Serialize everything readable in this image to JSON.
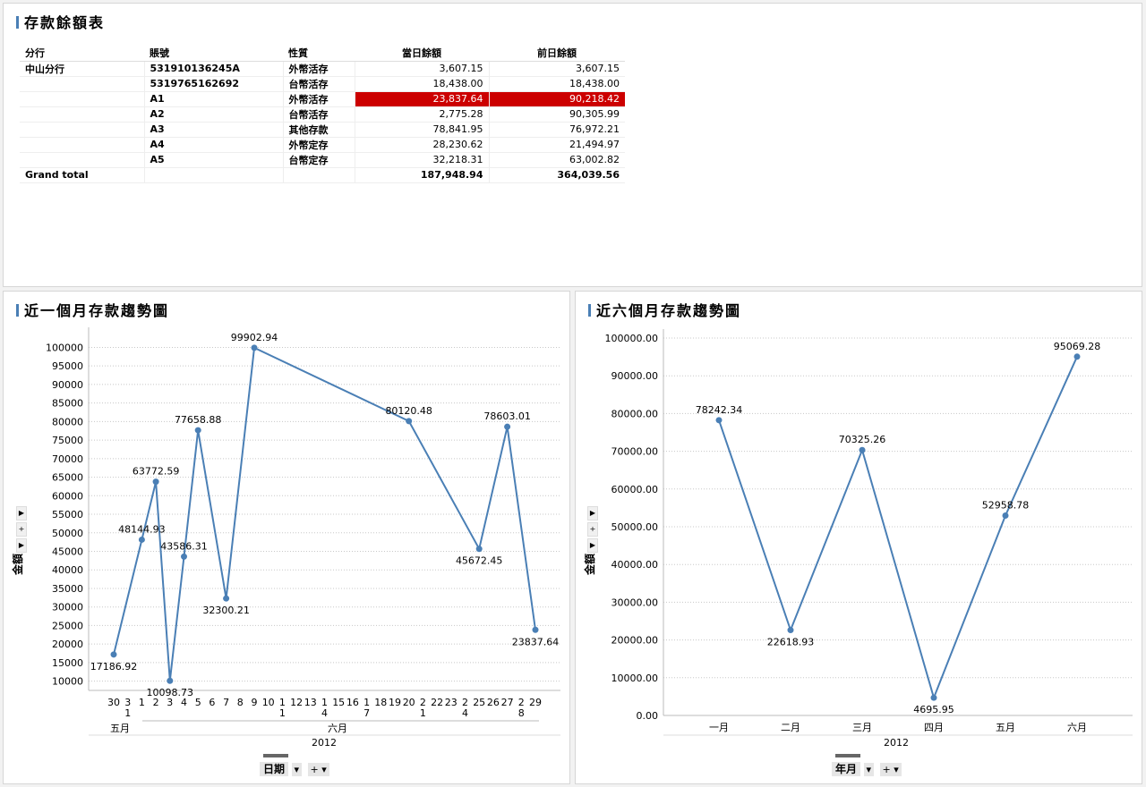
{
  "table_panel": {
    "title": "存款餘額表",
    "headers": [
      "分行",
      "賬號",
      "性質",
      "當日餘額",
      "前日餘額"
    ],
    "branch": "中山分行",
    "rows": [
      {
        "account": "531910136245A",
        "type": "外幣活存",
        "today": "3,607.15",
        "prev": "3,607.15"
      },
      {
        "account": "5319765162692",
        "type": "台幣活存",
        "today": "18,438.00",
        "prev": "18,438.00"
      },
      {
        "account": "A1",
        "type": "外幣活存",
        "today": "23,837.64",
        "prev": "90,218.42"
      },
      {
        "account": "A2",
        "type": "台幣活存",
        "today": "2,775.28",
        "prev": "90,305.99"
      },
      {
        "account": "A3",
        "type": "其他存款",
        "today": "78,841.95",
        "prev": "76,972.21"
      },
      {
        "account": "A4",
        "type": "外幣定存",
        "today": "28,230.62",
        "prev": "21,494.97"
      },
      {
        "account": "A5",
        "type": "台幣定存",
        "today": "32,218.31",
        "prev": "63,002.82"
      }
    ],
    "total_label": "Grand total",
    "total_today": "187,948.94",
    "total_prev": "364,039.56",
    "highlight_color": "#cc0000"
  },
  "chart_month_panel": {
    "title": "近一個月存款趨勢圖",
    "month_may": "五月",
    "month_jun": "六月",
    "year": "2012",
    "control_label": "日期",
    "plus": "+",
    "ylabel": "金額"
  },
  "chart_six_panel": {
    "title": "近六個月存款趨勢圖",
    "year": "2012",
    "control_label": "年月",
    "plus": "+",
    "ylabel": "金額"
  },
  "chart_data": [
    {
      "type": "line",
      "title": "近一個月存款趨勢圖",
      "ylabel": "金額",
      "ylim": [
        7500,
        103000
      ],
      "yticks": [
        10000,
        15000,
        20000,
        25000,
        30000,
        35000,
        40000,
        45000,
        50000,
        55000,
        60000,
        65000,
        70000,
        75000,
        80000,
        85000,
        90000,
        95000,
        100000
      ],
      "categories": [
        "30",
        "31",
        "1",
        "2",
        "3",
        "4",
        "5",
        "6",
        "7",
        "8",
        "9",
        "10",
        "11",
        "12",
        "13",
        "14",
        "15",
        "16",
        "17",
        "18",
        "19",
        "20",
        "21",
        "22",
        "23",
        "24",
        "25",
        "26",
        "27",
        "28",
        "29"
      ],
      "series_color": "#4a7fb5",
      "points": [
        {
          "x": "30",
          "y": 17186.92,
          "label": "17186.92",
          "pos": "below"
        },
        {
          "x": "1",
          "y": 48144.93,
          "label": "48144.93",
          "pos": "above"
        },
        {
          "x": "2",
          "y": 63772.59,
          "label": "63772.59",
          "pos": "above"
        },
        {
          "x": "3",
          "y": 10098.73,
          "label": "10098.73",
          "pos": "below"
        },
        {
          "x": "4",
          "y": 43586.31,
          "label": "43586.31",
          "pos": "above"
        },
        {
          "x": "5",
          "y": 77658.88,
          "label": "77658.88",
          "pos": "above"
        },
        {
          "x": "7",
          "y": 32300.21,
          "label": "32300.21",
          "pos": "below"
        },
        {
          "x": "9",
          "y": 99902.94,
          "label": "99902.94",
          "pos": "above"
        },
        {
          "x": "20",
          "y": 80120.48,
          "label": "80120.48",
          "pos": "above"
        },
        {
          "x": "25",
          "y": 45672.45,
          "label": "45672.45",
          "pos": "below"
        },
        {
          "x": "27",
          "y": 78603.01,
          "label": "78603.01",
          "pos": "above"
        },
        {
          "x": "29",
          "y": 23837.64,
          "label": "23837.64",
          "pos": "below"
        }
      ]
    },
    {
      "type": "line",
      "title": "近六個月存款趨勢圖",
      "ylabel": "金額",
      "ylim": [
        0,
        100000
      ],
      "yticks": [
        "0.00",
        "10000.00",
        "20000.00",
        "30000.00",
        "40000.00",
        "50000.00",
        "60000.00",
        "70000.00",
        "80000.00",
        "90000.00",
        "100000.00"
      ],
      "categories": [
        "一月",
        "二月",
        "三月",
        "四月",
        "五月",
        "六月"
      ],
      "series_color": "#4a7fb5",
      "points": [
        {
          "x": "一月",
          "y": 78242.34,
          "label": "78242.34",
          "pos": "above"
        },
        {
          "x": "二月",
          "y": 22618.93,
          "label": "22618.93",
          "pos": "below"
        },
        {
          "x": "三月",
          "y": 70325.26,
          "label": "70325.26",
          "pos": "above"
        },
        {
          "x": "四月",
          "y": 4695.95,
          "label": "4695.95",
          "pos": "below"
        },
        {
          "x": "五月",
          "y": 52958.78,
          "label": "52958.78",
          "pos": "above"
        },
        {
          "x": "六月",
          "y": 95069.28,
          "label": "95069.28",
          "pos": "above"
        }
      ]
    }
  ]
}
